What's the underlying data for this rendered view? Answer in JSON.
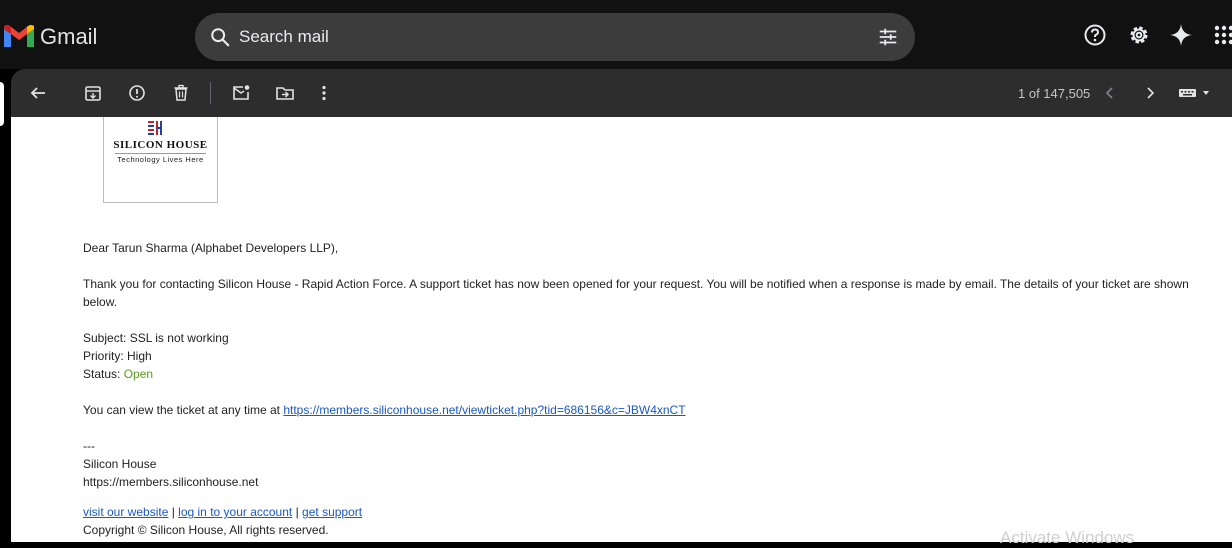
{
  "header": {
    "app_name": "Gmail",
    "search_placeholder": "Search mail"
  },
  "toolbar": {
    "pagination": "1 of 147,505"
  },
  "email": {
    "logo": {
      "brand": "SILICON HOUSE",
      "tagline": "Technology Lives Here"
    },
    "greeting": "Dear Tarun Sharma (Alphabet Developers LLP),",
    "intro": "Thank you for contacting Silicon House - Rapid Action Force. A support ticket has now been opened for your request. You will be notified when a response is made by email. The details of your ticket are shown below.",
    "subject": "Subject: SSL is not working",
    "priority": "Priority: High",
    "status_label": "Status: ",
    "status_value": "Open",
    "view_prefix": "You can view the ticket at any time at ",
    "ticket_url": "https://members.siliconhouse.net/viewticket.php?tid=686156&c=JBW4xnCT",
    "sig_dashes": "---",
    "sig_name": "Silicon House",
    "sig_url": "https://members.siliconhouse.net",
    "footer_links": [
      "visit our website",
      "log in to your account",
      "get support"
    ],
    "footer_sep": " | ",
    "copyright": "Copyright © Silicon House, All rights reserved."
  },
  "overlay": {
    "watermark": "Activate Windows"
  },
  "colors": {
    "status_open": "#5b9a1d",
    "link": "#1a57c9",
    "toolbar_bg": "#2d2d2d",
    "topbar_bg": "#111111"
  }
}
